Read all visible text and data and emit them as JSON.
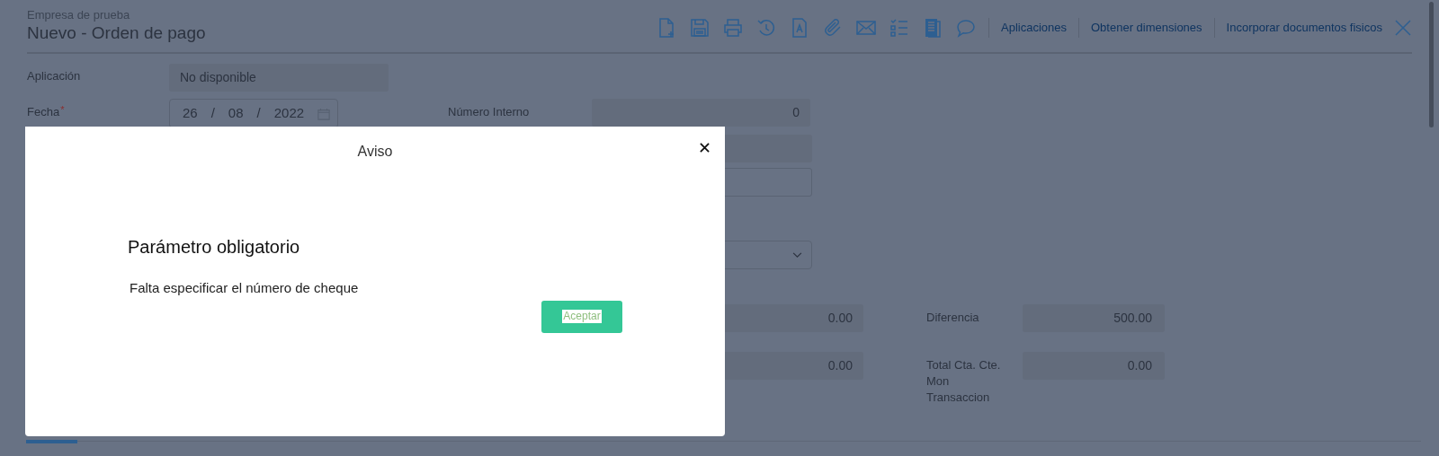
{
  "header": {
    "company": "Empresa de prueba",
    "title": "Nuevo - Orden de pago"
  },
  "toolbar": {
    "icons": [
      {
        "kind": "new"
      },
      {
        "kind": "save"
      },
      {
        "kind": "print"
      },
      {
        "kind": "history"
      },
      {
        "kind": "text"
      },
      {
        "kind": "attach"
      },
      {
        "kind": "mail"
      },
      {
        "kind": "checklist"
      },
      {
        "kind": "notebook"
      },
      {
        "kind": "comment"
      }
    ],
    "links": [
      "Aplicaciones",
      "Obtener dimensiones",
      "Incorporar documentos fisicos"
    ]
  },
  "form": {
    "aplicacion": {
      "label": "Aplicación",
      "value": "No disponible"
    },
    "fecha": {
      "label": "Fecha",
      "required": true,
      "required_mark": "*",
      "day": "26",
      "month": "08",
      "year": "2022",
      "separator": "/"
    },
    "numero_interno": {
      "label": "Número Interno",
      "value": "0"
    },
    "amounts": [
      {
        "left_value": "0.00",
        "label": "Diferencia",
        "value": "500.00"
      },
      {
        "left_value": "0.00",
        "label": "Total Cta. Cte. Mon Transaccion",
        "value": "0.00"
      }
    ]
  },
  "dialog": {
    "title": "Aviso",
    "heading": "Parámetro obligatorio",
    "message": "Falta especificar el número de cheque",
    "button": "Aceptar"
  }
}
